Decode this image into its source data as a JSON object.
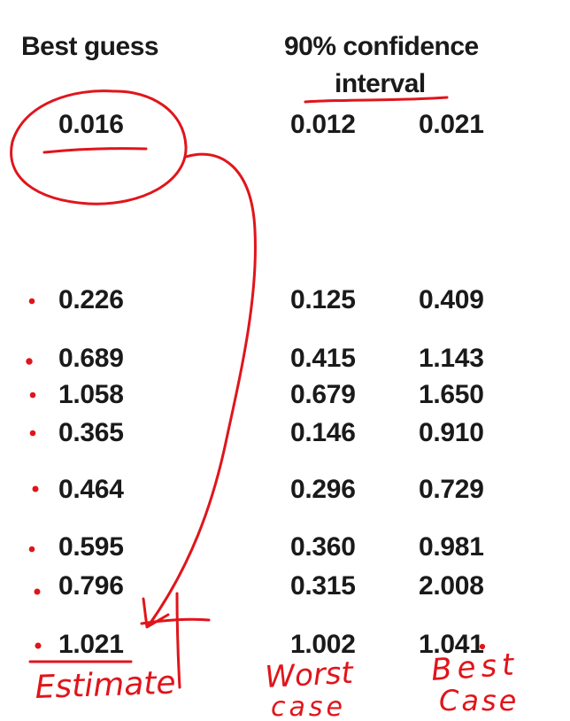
{
  "headers": {
    "best_guess": "Best guess",
    "ci_line1": "90% confidence",
    "ci_line2": "interval"
  },
  "rows": [
    {
      "best": "0.016",
      "low": "0.012",
      "high": "0.021"
    },
    {
      "best": "0.226",
      "low": "0.125",
      "high": "0.409"
    },
    {
      "best": "0.689",
      "low": "0.415",
      "high": "1.143"
    },
    {
      "best": "1.058",
      "low": "0.679",
      "high": "1.650"
    },
    {
      "best": "0.365",
      "low": "0.146",
      "high": "0.910"
    },
    {
      "best": "0.464",
      "low": "0.296",
      "high": "0.729"
    },
    {
      "best": "0.595",
      "low": "0.360",
      "high": "0.981"
    },
    {
      "best": "0.796",
      "low": "0.315",
      "high": "2.008"
    },
    {
      "best": "1.021",
      "low": "1.002",
      "high": "1.041"
    }
  ],
  "annotations": {
    "estimate": "Estimate",
    "worst_line1": "Worst",
    "worst_line2": "case",
    "best_line1": "Best",
    "best_line2": "Case"
  },
  "colors": {
    "text": "#1a1a1a",
    "ink": "#e0151b"
  }
}
